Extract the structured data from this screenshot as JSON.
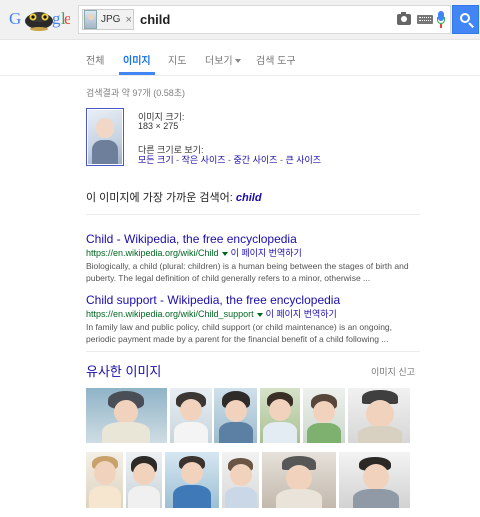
{
  "header": {
    "logo_letters": [
      "G",
      "o",
      "o",
      "g",
      "l",
      "e"
    ],
    "image_chip": {
      "label": "JPG",
      "close": "×"
    },
    "query": "child"
  },
  "tabs": [
    {
      "label": "전체",
      "active": false
    },
    {
      "label": "이미지",
      "active": true
    },
    {
      "label": "지도",
      "active": false
    },
    {
      "label": "더보기",
      "active": false
    },
    {
      "label": "검색 도구",
      "active": false
    }
  ],
  "stats": "검색결과 약 97개 (0.58초)",
  "query_image": {
    "size_label": "이미지 크기:",
    "size_value": "183 × 275",
    "other_sizes_label": "다른 크기로 보기:",
    "links": [
      "모든 크기",
      "작은 사이즈",
      "중간 사이즈",
      "큰 사이즈"
    ],
    "separator": " - "
  },
  "best_guess": {
    "label": "이 이미지에 가장 가까운 검색어:",
    "term": "child"
  },
  "results": [
    {
      "title": "Child - Wikipedia, the free encyclopedia",
      "url": "https://en.wikipedia.org/wiki/Child",
      "translate": "이 페이지 번역하기",
      "snippet": "Biologically, a child (plural: children) is a human being between the stages of birth and puberty. The legal definition of child generally refers to a minor, otherwise ..."
    },
    {
      "title": "Child support - Wikipedia, the free encyclopedia",
      "url": "https://en.wikipedia.org/wiki/Child_support",
      "translate": "이 페이지 번역하기",
      "snippet": "In family law and public policy, child support (or child maintenance) is an ongoing, periodic payment made by a parent for the financial benefit of a child following ..."
    }
  ],
  "similar": {
    "title": "유사한 이미지",
    "report": "이미지 신고"
  },
  "colors": {
    "link": "#1a0dab",
    "url": "#006621",
    "accent": "#4285f4",
    "snippet": "#545454"
  },
  "icons": [
    "camera-icon",
    "keyboard-icon",
    "microphone-icon",
    "search-icon",
    "close-icon",
    "caret-down-icon"
  ]
}
